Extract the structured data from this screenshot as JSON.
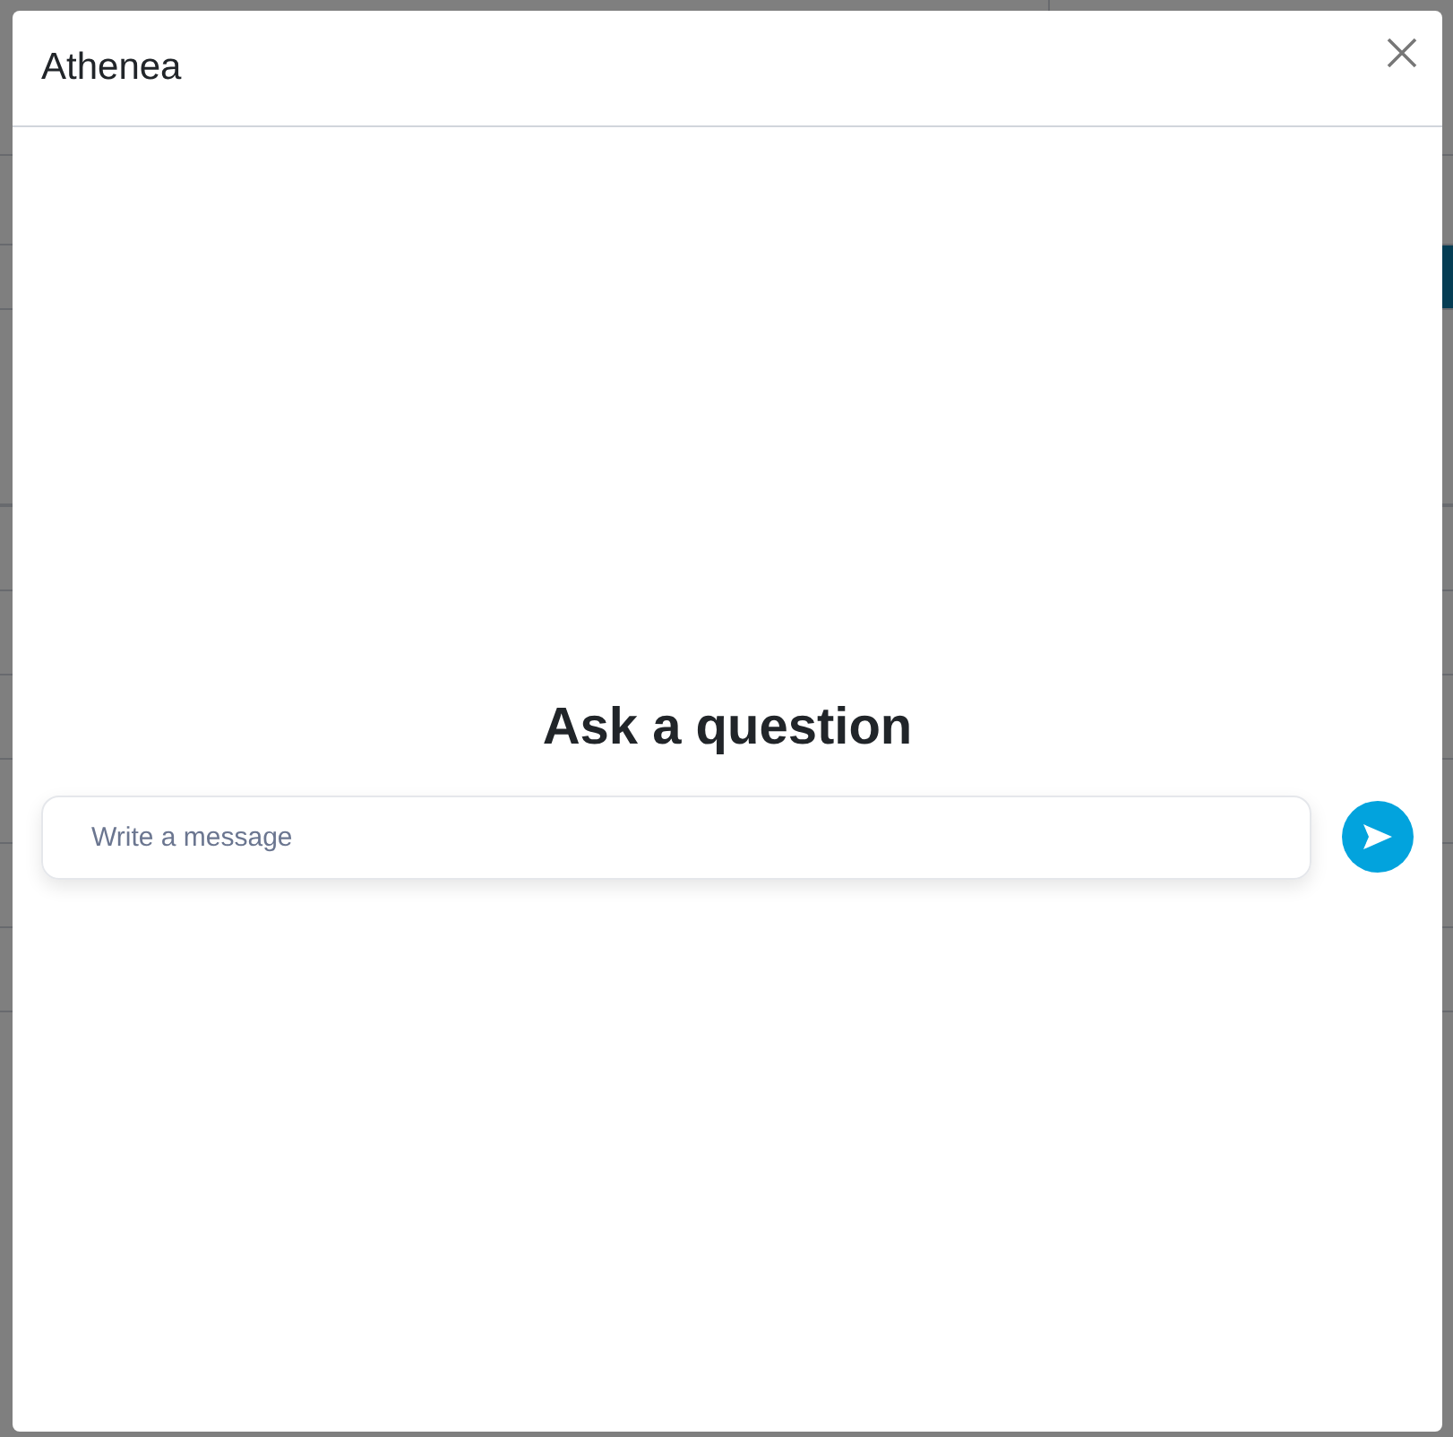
{
  "modal": {
    "title": "Athenea",
    "heading": "Ask a question",
    "message": {
      "placeholder": "Write a message"
    }
  }
}
